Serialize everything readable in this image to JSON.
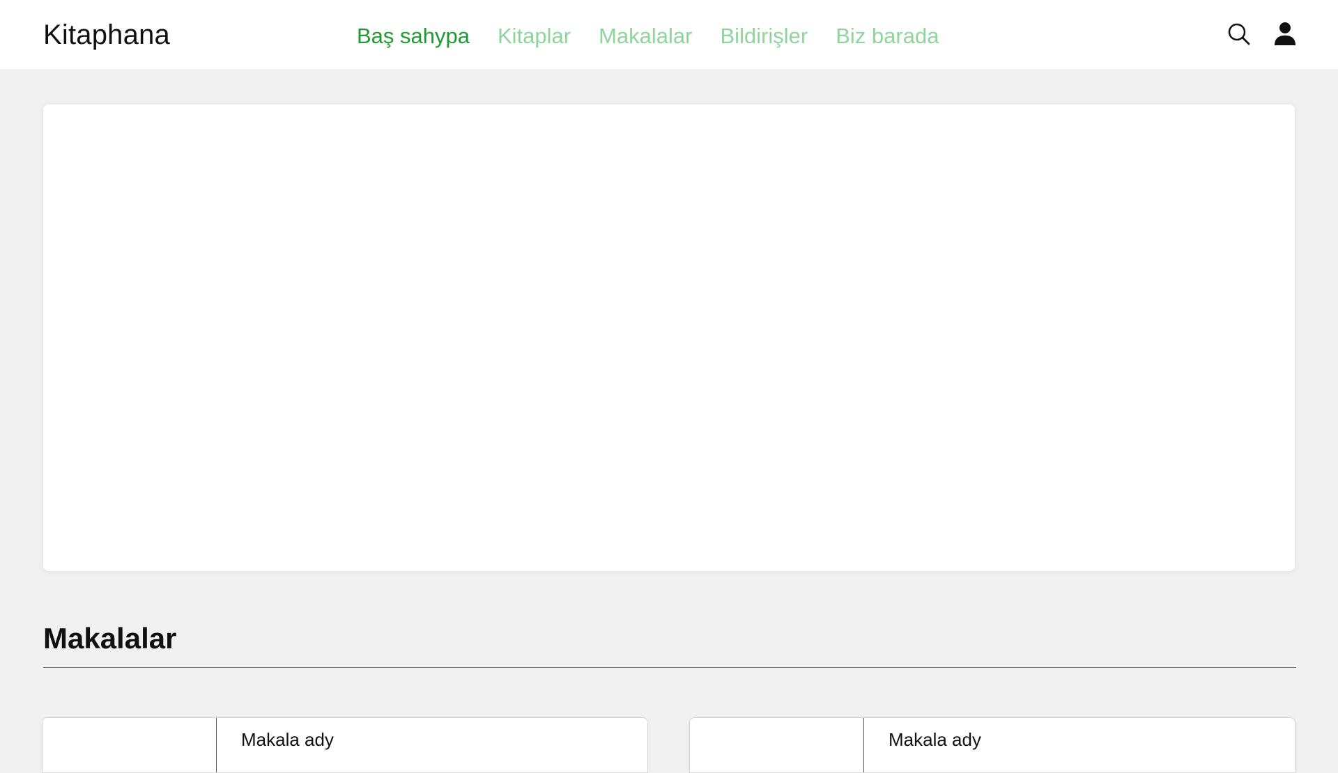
{
  "header": {
    "brand": "Kitaphana",
    "nav": [
      {
        "label": "Baş sahypa",
        "active": true
      },
      {
        "label": "Kitaplar",
        "active": false
      },
      {
        "label": "Makalalar",
        "active": false
      },
      {
        "label": "Bildirişler",
        "active": false
      },
      {
        "label": "Biz barada",
        "active": false
      }
    ],
    "icons": [
      "search-icon",
      "user-icon"
    ]
  },
  "main": {
    "section_title": "Makalalar",
    "articles": [
      {
        "title": "Makala ady"
      },
      {
        "title": "Makala ady"
      }
    ]
  },
  "colors": {
    "accent_active": "#1f9a33",
    "accent_inactive": "#8fd49b",
    "background": "#f1f1f1"
  }
}
